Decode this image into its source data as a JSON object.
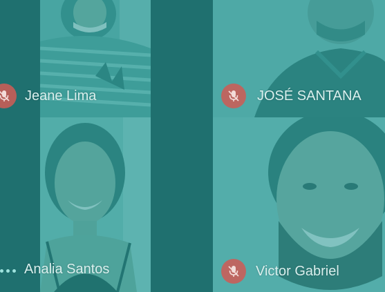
{
  "participants": [
    {
      "name": "Jeane Lima",
      "muted": true
    },
    {
      "name": "JOSÉ SANTANA",
      "muted": true
    },
    {
      "name": "Analia Santos",
      "muted": false
    },
    {
      "name": "Victor Gabriel",
      "muted": true
    }
  ],
  "icons": {
    "mic_off": "mic-off-icon",
    "more": "more-dots-icon"
  },
  "colors": {
    "background": "#1f6f6e",
    "tile_tint": "#4aa3a0",
    "muted_badge": "#cc5c56",
    "name_text": "#d9f0ee"
  }
}
